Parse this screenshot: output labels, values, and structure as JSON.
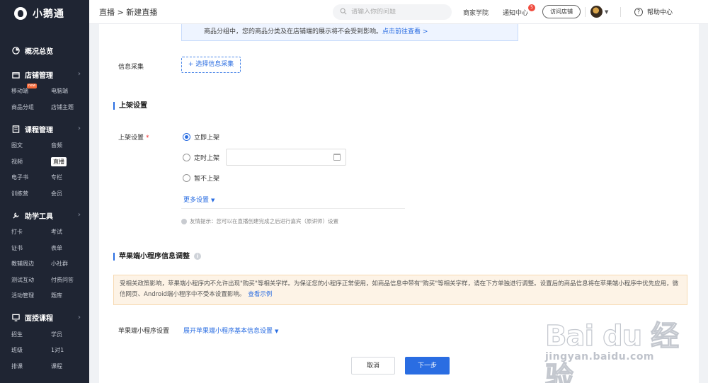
{
  "app": {
    "name": "小鹅通"
  },
  "sidebar": {
    "overview": "概况总览",
    "groups": [
      {
        "title": "店铺管理",
        "icon": "shop-icon",
        "items": [
          "移动端",
          "电脑端",
          "商品分组",
          "店铺主题"
        ],
        "badge": "new"
      },
      {
        "title": "课程管理",
        "icon": "course-icon",
        "items": [
          "图文",
          "音频",
          "视频",
          "直播",
          "电子书",
          "专栏",
          "训练营",
          "会员"
        ],
        "active": "直播"
      },
      {
        "title": "助学工具",
        "icon": "tool-icon",
        "items": [
          "打卡",
          "考试",
          "证书",
          "表单",
          "教辅周边",
          "小社群",
          "测试互动",
          "付费问答",
          "活动管理",
          "题库"
        ]
      },
      {
        "title": "面授课程",
        "icon": "class-icon",
        "items": [
          "招生",
          "学员",
          "班级",
          "1对1",
          "排课",
          "课程"
        ]
      }
    ]
  },
  "topbar": {
    "breadcrumb": "直播 > 新建直播",
    "search_placeholder": "请输入你的问题",
    "business_school": "商家学院",
    "notifications": "通知中心",
    "notif_count": "5",
    "visit_store": "访问店铺",
    "help": "帮助中心"
  },
  "form": {
    "group_note": "商品分组中，您的商品分类及在店铺端的展示将不会受到影响。",
    "group_note_link": "点击前往查看 >",
    "info_collect_label": "信息采集",
    "info_collect_button": "+ 选择信息采集",
    "listing_section": "上架设置",
    "listing_label": "上架设置",
    "required_mark": "*",
    "options": [
      "立即上架",
      "定时上架",
      "暂不上架"
    ],
    "selected_option": "立即上架",
    "more_settings": "更多设置",
    "tip": "友情提示：您可以在直播创建完成之后进行嘉宾（原讲师）设置",
    "apple_section": "苹果端小程序信息调整",
    "warning": "受相关政策影响，苹果端小程序内不允许出现\"购买\"等相关字样。为保证您的小程序正常使用，如商品信息中带有\"购买\"等相关字样，请在下方单独进行调整。设置后的商品信息将在苹果端小程序中优先应用，微信网页、Android端小程序中不受本设置影响。",
    "warning_link": "查看示例",
    "apple_label": "苹果端小程序设置",
    "apple_expand": "展开苹果端小程序基本信息设置",
    "cancel": "取消",
    "next": "下一步"
  },
  "watermark": {
    "main": "Bai du 经验",
    "url": "jingyan.baidu.com"
  },
  "colors": {
    "sidebar_bg": "#1f2533",
    "primary": "#2a6de2",
    "warning_bg": "#fdf3e6"
  }
}
